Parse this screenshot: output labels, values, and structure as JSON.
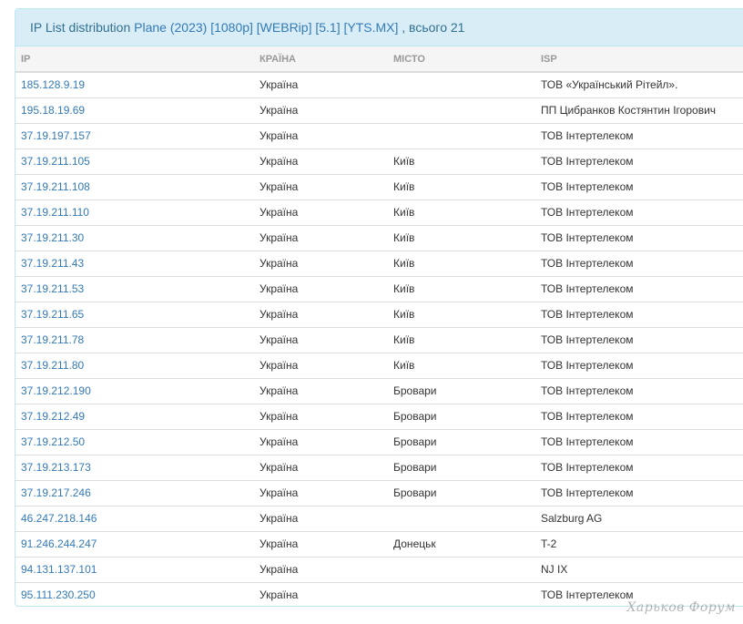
{
  "panel": {
    "title_prefix": "IP List distribution",
    "title_link": "Plane (2023) [1080p] [WEBRip] [5.1] [YTS.MX]",
    "title_suffix": ", всього 21"
  },
  "table": {
    "columns": [
      "IP",
      "КРАЇНА",
      "МІСТО",
      "ISP"
    ],
    "rows": [
      {
        "ip": "185.128.9.19",
        "country": "Україна",
        "city": "",
        "isp": "ТОВ «Український Рітейл»."
      },
      {
        "ip": "195.18.19.69",
        "country": "Україна",
        "city": "",
        "isp": "ПП Цибранков Костянтин Ігорович"
      },
      {
        "ip": "37.19.197.157",
        "country": "Україна",
        "city": "",
        "isp": "ТОВ Інтертелеком"
      },
      {
        "ip": "37.19.211.105",
        "country": "Україна",
        "city": "Київ",
        "isp": "ТОВ Інтертелеком"
      },
      {
        "ip": "37.19.211.108",
        "country": "Україна",
        "city": "Київ",
        "isp": "ТОВ Інтертелеком"
      },
      {
        "ip": "37.19.211.110",
        "country": "Україна",
        "city": "Київ",
        "isp": "ТОВ Інтертелеком"
      },
      {
        "ip": "37.19.211.30",
        "country": "Україна",
        "city": "Київ",
        "isp": "ТОВ Інтертелеком"
      },
      {
        "ip": "37.19.211.43",
        "country": "Україна",
        "city": "Київ",
        "isp": "ТОВ Інтертелеком"
      },
      {
        "ip": "37.19.211.53",
        "country": "Україна",
        "city": "Київ",
        "isp": "ТОВ Інтертелеком"
      },
      {
        "ip": "37.19.211.65",
        "country": "Україна",
        "city": "Київ",
        "isp": "ТОВ Інтертелеком"
      },
      {
        "ip": "37.19.211.78",
        "country": "Україна",
        "city": "Київ",
        "isp": "ТОВ Інтертелеком"
      },
      {
        "ip": "37.19.211.80",
        "country": "Україна",
        "city": "Київ",
        "isp": "ТОВ Інтертелеком"
      },
      {
        "ip": "37.19.212.190",
        "country": "Україна",
        "city": "Бровари",
        "isp": "ТОВ Інтертелеком"
      },
      {
        "ip": "37.19.212.49",
        "country": "Україна",
        "city": "Бровари",
        "isp": "ТОВ Інтертелеком"
      },
      {
        "ip": "37.19.212.50",
        "country": "Україна",
        "city": "Бровари",
        "isp": "ТОВ Інтертелеком"
      },
      {
        "ip": "37.19.213.173",
        "country": "Україна",
        "city": "Бровари",
        "isp": "ТОВ Інтертелеком"
      },
      {
        "ip": "37.19.217.246",
        "country": "Україна",
        "city": "Бровари",
        "isp": "ТОВ Інтертелеком"
      },
      {
        "ip": "46.247.218.146",
        "country": "Україна",
        "city": "",
        "isp": "Salzburg AG"
      },
      {
        "ip": "91.246.244.247",
        "country": "Україна",
        "city": "Донецьк",
        "isp": "T-2"
      },
      {
        "ip": "94.131.137.101",
        "country": "Україна",
        "city": "",
        "isp": "NJ IX"
      },
      {
        "ip": "95.111.230.250",
        "country": "Україна",
        "city": "",
        "isp": "ТОВ Інтертелеком"
      }
    ]
  },
  "watermark": "Харьков Форум"
}
